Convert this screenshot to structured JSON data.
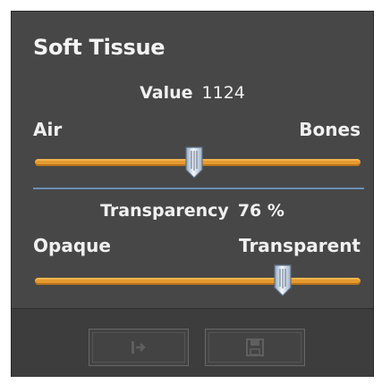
{
  "panel": {
    "title": "Soft Tissue"
  },
  "value_slider": {
    "label": "Value",
    "value": "1124",
    "min_label": "Air",
    "max_label": "Bones",
    "fraction": 0.49
  },
  "transparency_slider": {
    "label": "Transparency",
    "value": "76 %",
    "min_label": "Opaque",
    "max_label": "Transparent",
    "fraction": 0.76
  },
  "toolbar": {
    "buttons": [
      {
        "icon": "apply-icon"
      },
      {
        "icon": "save-icon"
      }
    ]
  },
  "colors": {
    "panel_bg": "#474747",
    "track": "#e69a2e",
    "divider": "#6a8fb3"
  }
}
